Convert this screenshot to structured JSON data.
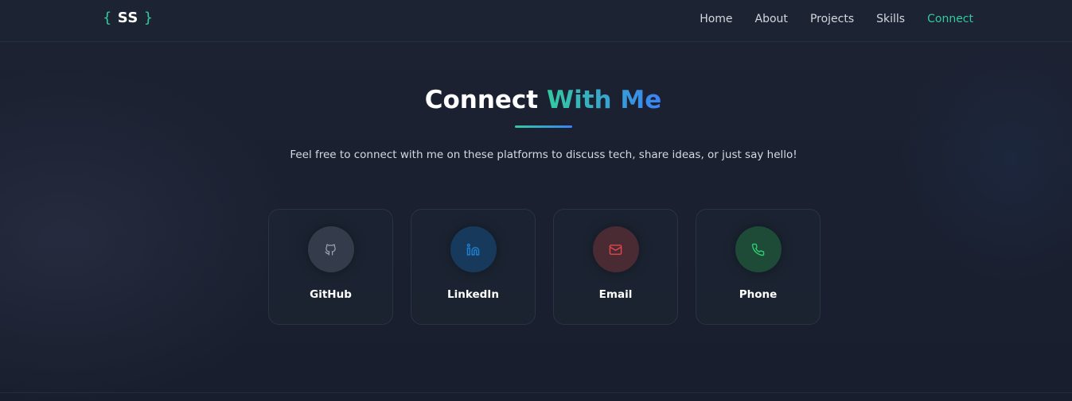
{
  "nav": {
    "logo_open": "{",
    "logo_text": "SS",
    "logo_close": "}",
    "links": [
      {
        "label": "Home"
      },
      {
        "label": "About"
      },
      {
        "label": "Projects"
      },
      {
        "label": "Skills"
      },
      {
        "label": "Connect",
        "active": true
      }
    ]
  },
  "section": {
    "title_plain": "Connect ",
    "title_accent": "With Me",
    "subtitle": "Feel free to connect with me on these platforms to discuss tech, share ideas, or just say hello!"
  },
  "cards": [
    {
      "label": "GitHub",
      "icon": "github-icon",
      "color": "#9aa3b2",
      "bg": "#343b4a"
    },
    {
      "label": "LinkedIn",
      "icon": "linkedin-icon",
      "color": "#1d7fd1",
      "bg": "#173a5c"
    },
    {
      "label": "Email",
      "icon": "mail-icon",
      "color": "#e0474a",
      "bg": "#4a2a33"
    },
    {
      "label": "Phone",
      "icon": "phone-icon",
      "color": "#2ecc71",
      "bg": "#1e4a38"
    }
  ],
  "colors": {
    "accent": "#34c9a0",
    "accent_secondary": "#3b82f6",
    "background": "#1a2030"
  }
}
